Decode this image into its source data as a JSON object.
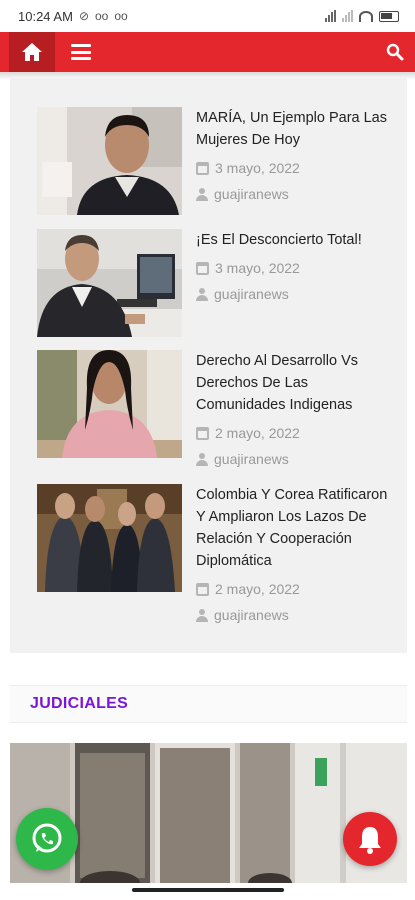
{
  "status_bar": {
    "time": "10:24 AM"
  },
  "navbar": {
    "home_icon": "home-icon",
    "menu_icon": "menu-icon",
    "search_icon": "search-icon",
    "color": "#e3272d"
  },
  "news": [
    {
      "title": "MARÍA, Un Ejemplo Para Las Mujeres De Hoy",
      "date": "3 mayo, 2022",
      "author": "guajiranews"
    },
    {
      "title": "¡Es El Desconcierto Total!",
      "date": "3 mayo, 2022",
      "author": "guajiranews"
    },
    {
      "title": "Derecho Al Desarrollo Vs Derechos De Las Comunidades Indigenas",
      "date": "2 mayo, 2022",
      "author": "guajiranews"
    },
    {
      "title": "Colombia Y Corea Ratificaron Y Ampliaron Los Lazos De Relación Y Cooperación Diplomática",
      "date": "2 mayo, 2022",
      "author": "guajiranews"
    }
  ],
  "section": {
    "title": "JUDICIALES",
    "color": "#7b16d6"
  },
  "floating": {
    "whatsapp_icon": "whatsapp-icon",
    "bell_icon": "bell-icon"
  }
}
